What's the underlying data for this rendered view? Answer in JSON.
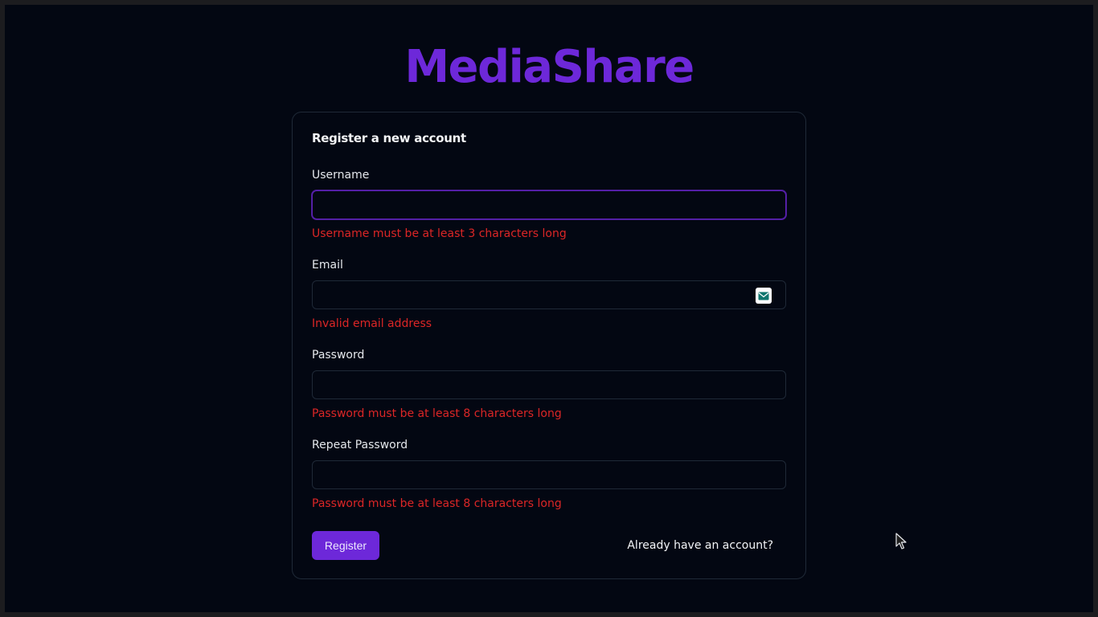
{
  "app": {
    "brand": "MediaShare"
  },
  "form": {
    "title": "Register a new account",
    "fields": [
      {
        "label": "Username",
        "value": "",
        "error": "Username must be at least 3 characters long"
      },
      {
        "label": "Email",
        "value": "",
        "error": "Invalid email address"
      },
      {
        "label": "Password",
        "value": "",
        "error": "Password must be at least 8 characters long"
      },
      {
        "label": "Repeat Password",
        "value": "",
        "error": "Password must be at least 8 characters long"
      }
    ],
    "submit_label": "Register",
    "login_link": "Already have an account?"
  },
  "icons": {
    "email_autofill": "mail-icon",
    "cursor": "mouse-pointer-icon"
  },
  "colors": {
    "background": "#030712",
    "accent": "#6d28d9",
    "error": "#dc2626",
    "border": "#1f2937",
    "text": "#e5e7eb"
  }
}
